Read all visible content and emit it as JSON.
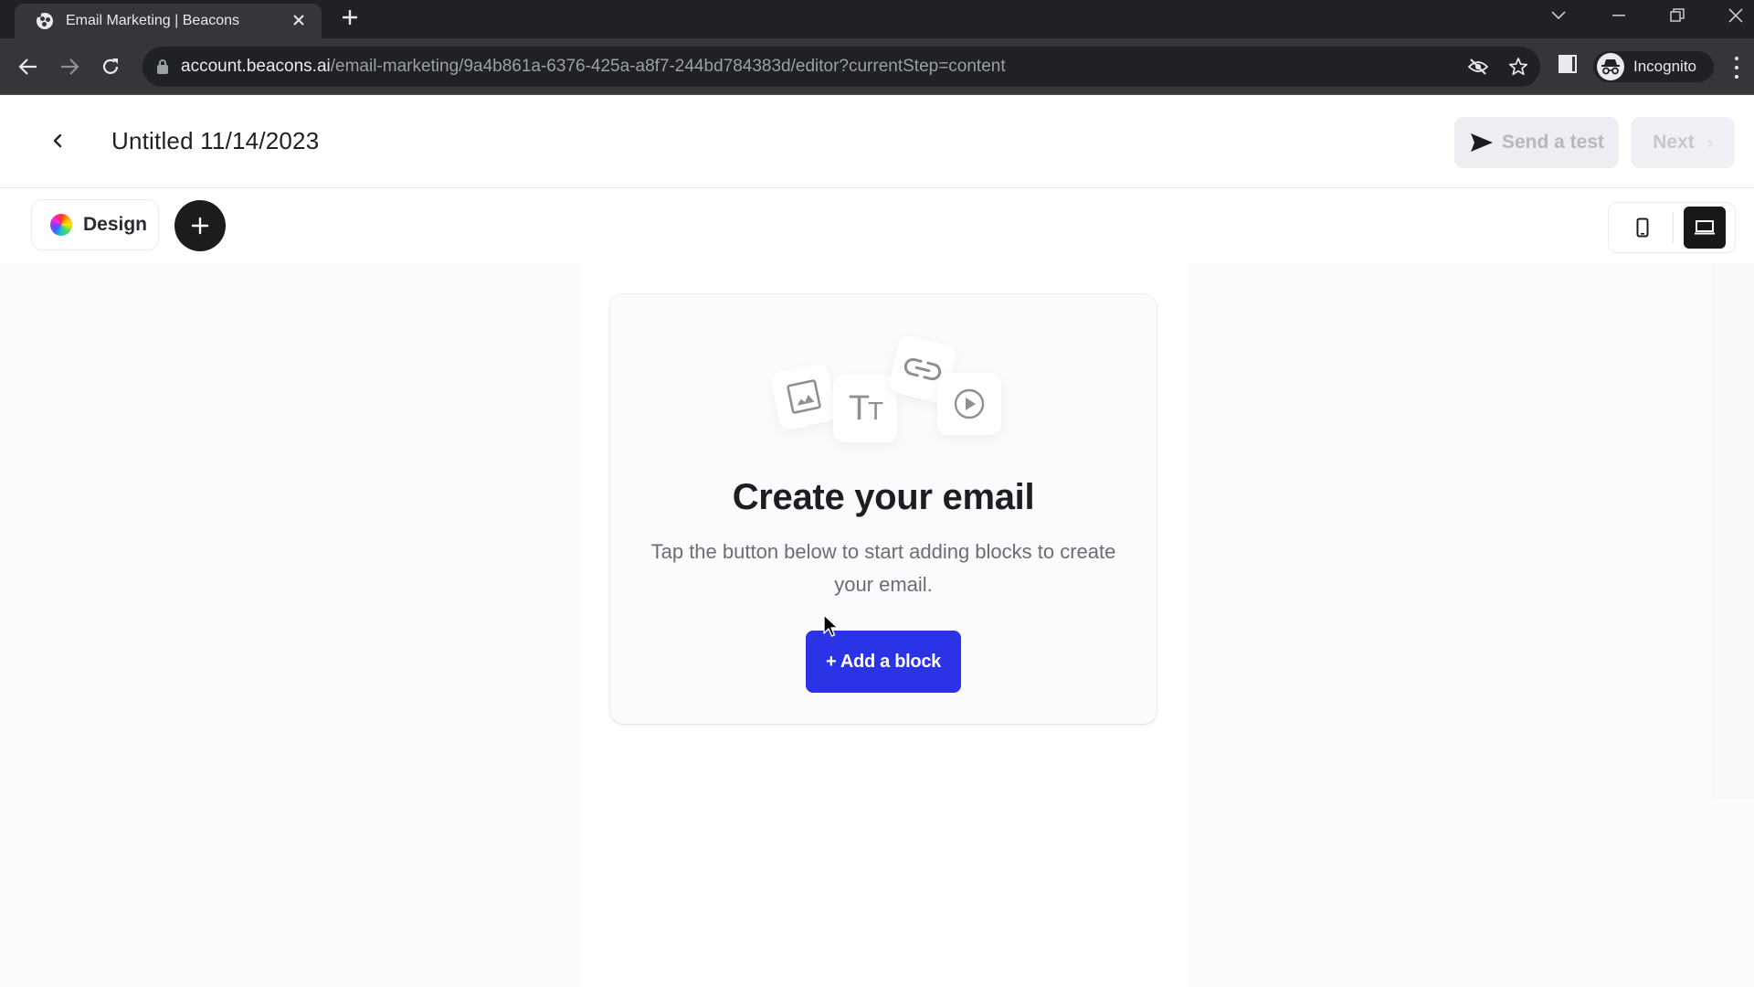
{
  "browser": {
    "tab": {
      "title": "Email Marketing | Beacons",
      "favicon": "beacons-logo-icon",
      "close_icon": "close-icon"
    },
    "new_tab_label": "+",
    "window_controls": [
      "tab-search-icon",
      "minimize-icon",
      "restore-icon",
      "close-icon"
    ],
    "url": {
      "host": "account.beacons.ai",
      "path": "/email-marketing/9a4b861a-6376-425a-a8f7-244bd784383d/editor?currentStep=content"
    },
    "omnibox_icons": [
      "eye-off-icon",
      "star-icon"
    ],
    "profile_label": "Incognito"
  },
  "header": {
    "title": "Untitled 11/14/2023",
    "send_test_label": "Send a test",
    "next_label": "Next",
    "next_chevron": "›"
  },
  "editor_toolbar": {
    "design_label": "Design",
    "add_label": "+",
    "device_modes": [
      {
        "name": "mobile",
        "selected": false
      },
      {
        "name": "desktop",
        "selected": true
      }
    ]
  },
  "empty_state": {
    "block_types": [
      "image",
      "text",
      "link",
      "video"
    ],
    "text_glyph": "Tт",
    "title": "Create your email",
    "subtitle": "Tap the button below to start adding blocks to create your email.",
    "button_label": "+ Add a block"
  },
  "colors": {
    "accent": "#2a34e6",
    "chrome_dark": "#202124",
    "chrome_toolbar": "#35363a",
    "dark_button": "#1c1c1f",
    "disabled_button_bg": "#eeedf1",
    "disabled_text": "#b8b7bd"
  }
}
